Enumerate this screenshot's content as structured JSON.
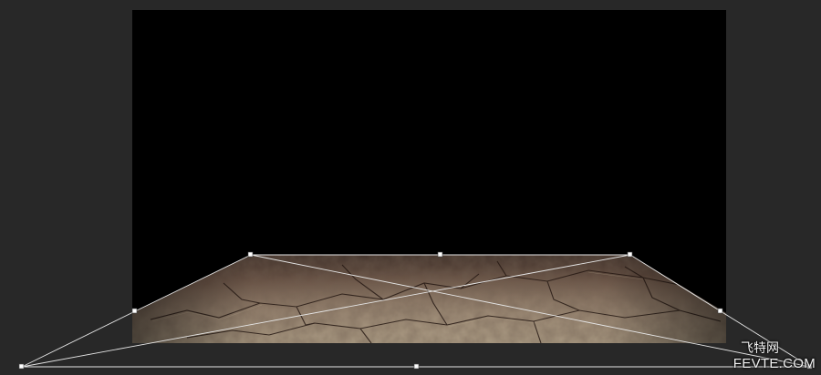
{
  "app": {
    "mode": "free-transform-perspective"
  },
  "colors": {
    "workspace": "#282828",
    "canvas": "#000000",
    "floor_light": "#b8a78e",
    "floor_mid": "#8a6f5c",
    "floor_dark": "#4a372c",
    "transform_line": "#e6e6e6",
    "handle_fill": "#ffffff"
  },
  "watermark": {
    "cn": "飞特网",
    "en": "FEVTE.COM"
  }
}
